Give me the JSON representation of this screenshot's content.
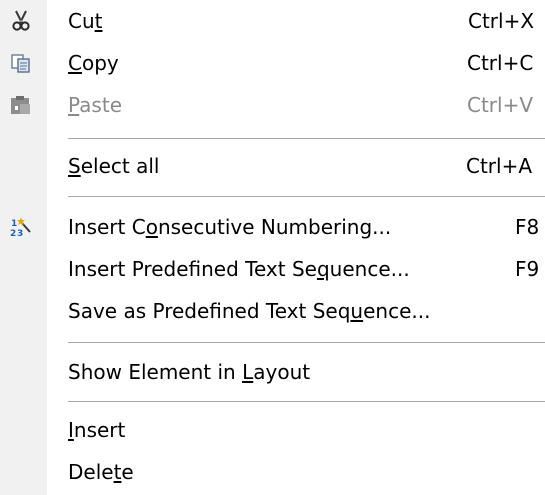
{
  "menu": {
    "cut": {
      "pre": "Cu",
      "key": "t",
      "post": "",
      "shortcut": "Ctrl+X",
      "icon": "scissors-icon"
    },
    "copy": {
      "pre": "",
      "key": "C",
      "post": "opy",
      "shortcut": "Ctrl+C",
      "icon": "copy-pages-icon"
    },
    "paste": {
      "pre": "",
      "key": "P",
      "post": "aste",
      "shortcut": "Ctrl+V",
      "icon": "clipboard-icon",
      "disabled": true
    },
    "select_all": {
      "pre": "",
      "key": "S",
      "post": "elect all",
      "shortcut": "Ctrl+A"
    },
    "insert_numbering": {
      "pre": "Insert C",
      "key": "o",
      "post": "nsecutive Numbering...",
      "shortcut": "F8",
      "icon": "numbering-wand-icon"
    },
    "insert_predefined": {
      "pre": "Insert Predefined Text Se",
      "key": "q",
      "post": "uence...",
      "shortcut": "F9"
    },
    "save_predefined": {
      "pre": "Save as Predefined Text Seq",
      "key": "u",
      "post": "ence...",
      "shortcut": ""
    },
    "show_element": {
      "pre": "Show Element in ",
      "key": "L",
      "post": "ayout",
      "shortcut": ""
    },
    "insert": {
      "pre": "",
      "key": "I",
      "post": "nsert",
      "shortcut": ""
    },
    "delete": {
      "pre": "Dele",
      "key": "t",
      "post": "e",
      "shortcut": ""
    }
  },
  "colors": {
    "gutter": "#f1f1f1",
    "separator": "#a8a8a8",
    "disabled_text": "#8a8a8a",
    "scissors_accent": "#2a2a2a",
    "wand_star": "#e8a400",
    "numbers": "#1d63b8"
  }
}
